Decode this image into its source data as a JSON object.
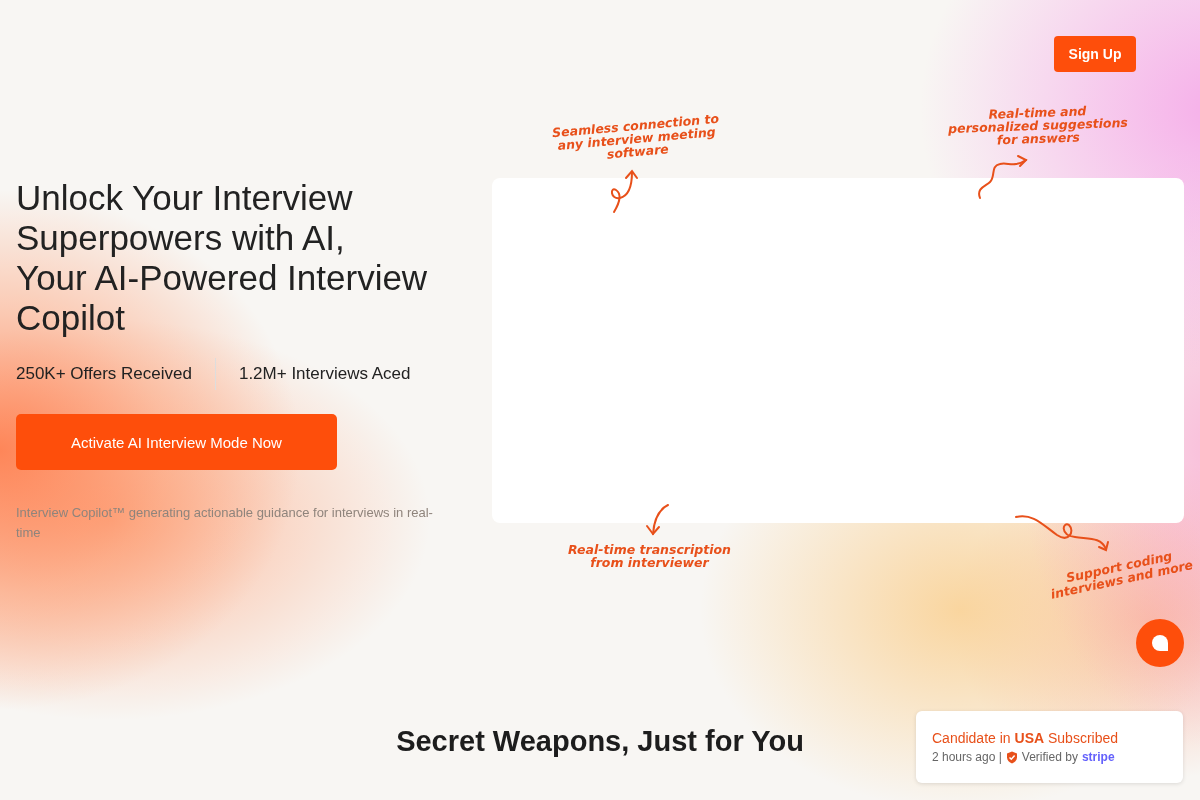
{
  "header": {
    "signup": "Sign Up"
  },
  "hero": {
    "title_lines": [
      "Unlock Your Interview",
      "Superpowers with AI,",
      "Your AI-Powered Interview",
      "Copilot"
    ],
    "stats": [
      "250K+ Offers Received",
      "1.2M+ Interviews Aced"
    ],
    "cta": "Activate AI Interview Mode Now",
    "description": "Interview Copilot™ generating actionable guidance for interviews in real-time"
  },
  "annotations": [
    {
      "lines": [
        "Seamless connection to",
        "any interview meeting",
        "software"
      ]
    },
    {
      "lines": [
        "Real-time and",
        "personalized suggestions",
        "for answers"
      ]
    },
    {
      "lines": [
        "Real-time transcription",
        "from interviewer"
      ]
    },
    {
      "lines": [
        "Support coding",
        "interviews and more"
      ]
    }
  ],
  "section_title": "Secret Weapons, Just for You",
  "toast": {
    "headline": "Candidate in **USA** Subscribed",
    "time": "2 hours ago |",
    "verified": "Verified by",
    "brand": "stripe"
  }
}
